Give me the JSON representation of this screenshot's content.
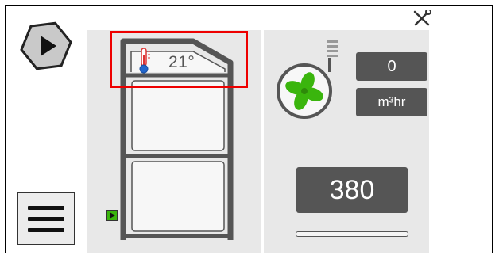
{
  "unit": {
    "temperature": "21°"
  },
  "airflow": {
    "value": "0",
    "unit": "m³hr"
  },
  "setpoint": {
    "value": "380",
    "level": 0.0
  },
  "icons": {
    "play": "play-icon",
    "menu": "hamburger-menu-icon",
    "tools": "wrench-screwdriver-icon",
    "thermometer": "thermometer-icon",
    "fan": "fan-icon",
    "indicator": "play-indicator-icon"
  },
  "colors": {
    "fan_green": "#3ab50d",
    "highlight_red": "#ee0000",
    "value_box": "#555555",
    "panel_bg": "#e8e8e8"
  }
}
